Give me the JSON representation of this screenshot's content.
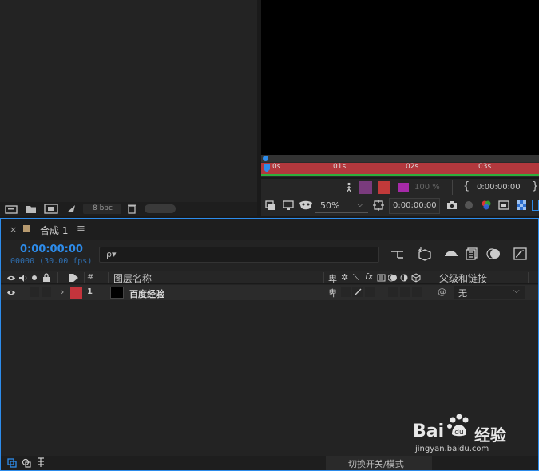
{
  "project": {
    "bpc_label": "8 bpc"
  },
  "viewer_timeline": {
    "ruler_marks": [
      "0s",
      "01s",
      "02s",
      "03s"
    ]
  },
  "viewer_controls": {
    "zoom_percent": "100 %",
    "timecode": "0:00:00:00",
    "magnification": "50%",
    "current_time": "0:00:00:00"
  },
  "timeline": {
    "tab_close": "×",
    "tab_label": "合成 1",
    "menu_icon": "≡",
    "timecode": "0:00:00:00",
    "frame_info": "00000 (30.00 fps)",
    "search_icon": "ρ▾",
    "columns": {
      "index": "#",
      "layer_name": "图层名称",
      "fx": "fx",
      "parent": "父级和链接"
    },
    "layer": {
      "index": "1",
      "name": "百度经验",
      "parent_value": "无",
      "label_color": "#c4343c"
    },
    "footer_toggle": "切换开关/模式"
  },
  "watermark": {
    "brand": "Bai",
    "brand2": "经验",
    "url": "jingyan.baidu.com"
  },
  "colors": {
    "accent": "#2d8ceb",
    "work_area": "#b2383d",
    "timecode_blue": "#2d8ceb"
  }
}
